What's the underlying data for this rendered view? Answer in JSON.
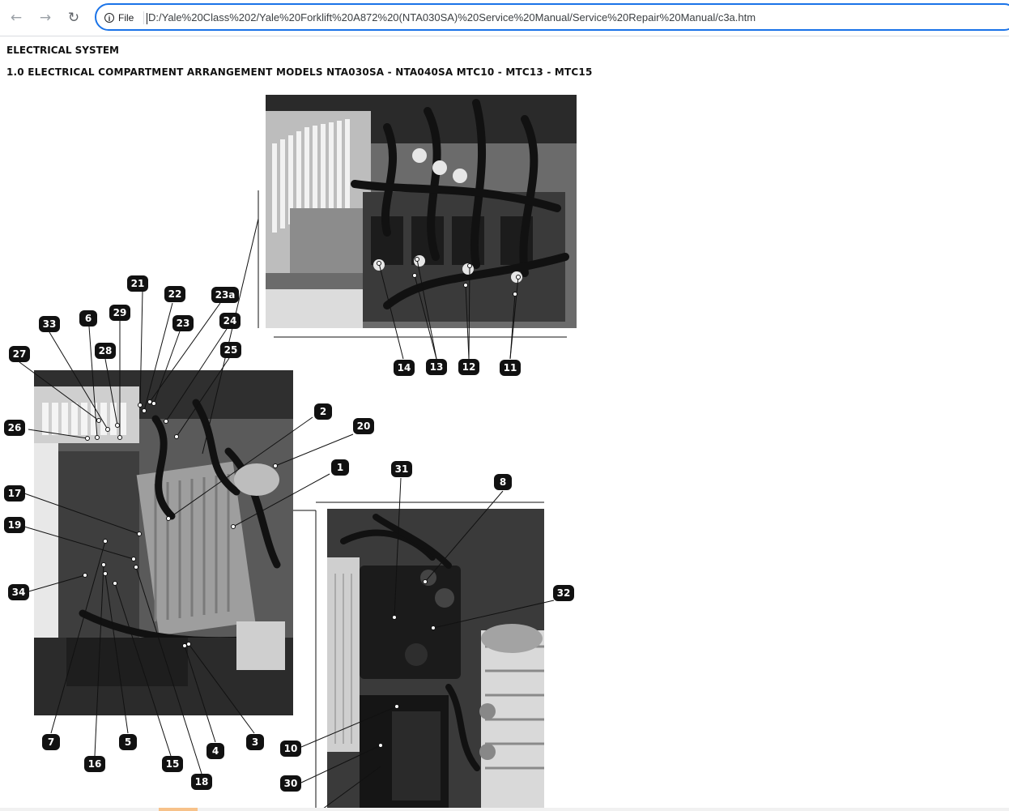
{
  "browser": {
    "back_icon": "arrow-left-icon",
    "forward_icon": "arrow-right-icon",
    "reload_icon": "reload-icon",
    "site_info_label": "File",
    "url": "D:/Yale%20Class%202/Yale%20Forklift%20A872%20(NTA030SA)%20Service%20Manual/Service%20Repair%20Manual/c3a.htm"
  },
  "page": {
    "title": "ELECTRICAL SYSTEM",
    "subtitle": "1.0 ELECTRICAL COMPARTMENT ARRANGEMENT MODELS NTA030SA - NTA040SA MTC10 - MTC13 - MTC15"
  },
  "callouts": {
    "c1": "1",
    "c2": "2",
    "c3": "3",
    "c4": "4",
    "c5": "5",
    "c6": "6",
    "c7": "7",
    "c8": "8",
    "c10": "10",
    "c11": "11",
    "c12": "12",
    "c13": "13",
    "c14": "14",
    "c15": "15",
    "c16": "16",
    "c17": "17",
    "c18": "18",
    "c19": "19",
    "c20": "20",
    "c21": "21",
    "c22": "22",
    "c23": "23",
    "c23a": "23a",
    "c24": "24",
    "c25": "25",
    "c26": "26",
    "c27": "27",
    "c28": "28",
    "c29": "29",
    "c30": "30",
    "c31": "31",
    "c32": "32",
    "c33": "33",
    "c34": "34"
  }
}
